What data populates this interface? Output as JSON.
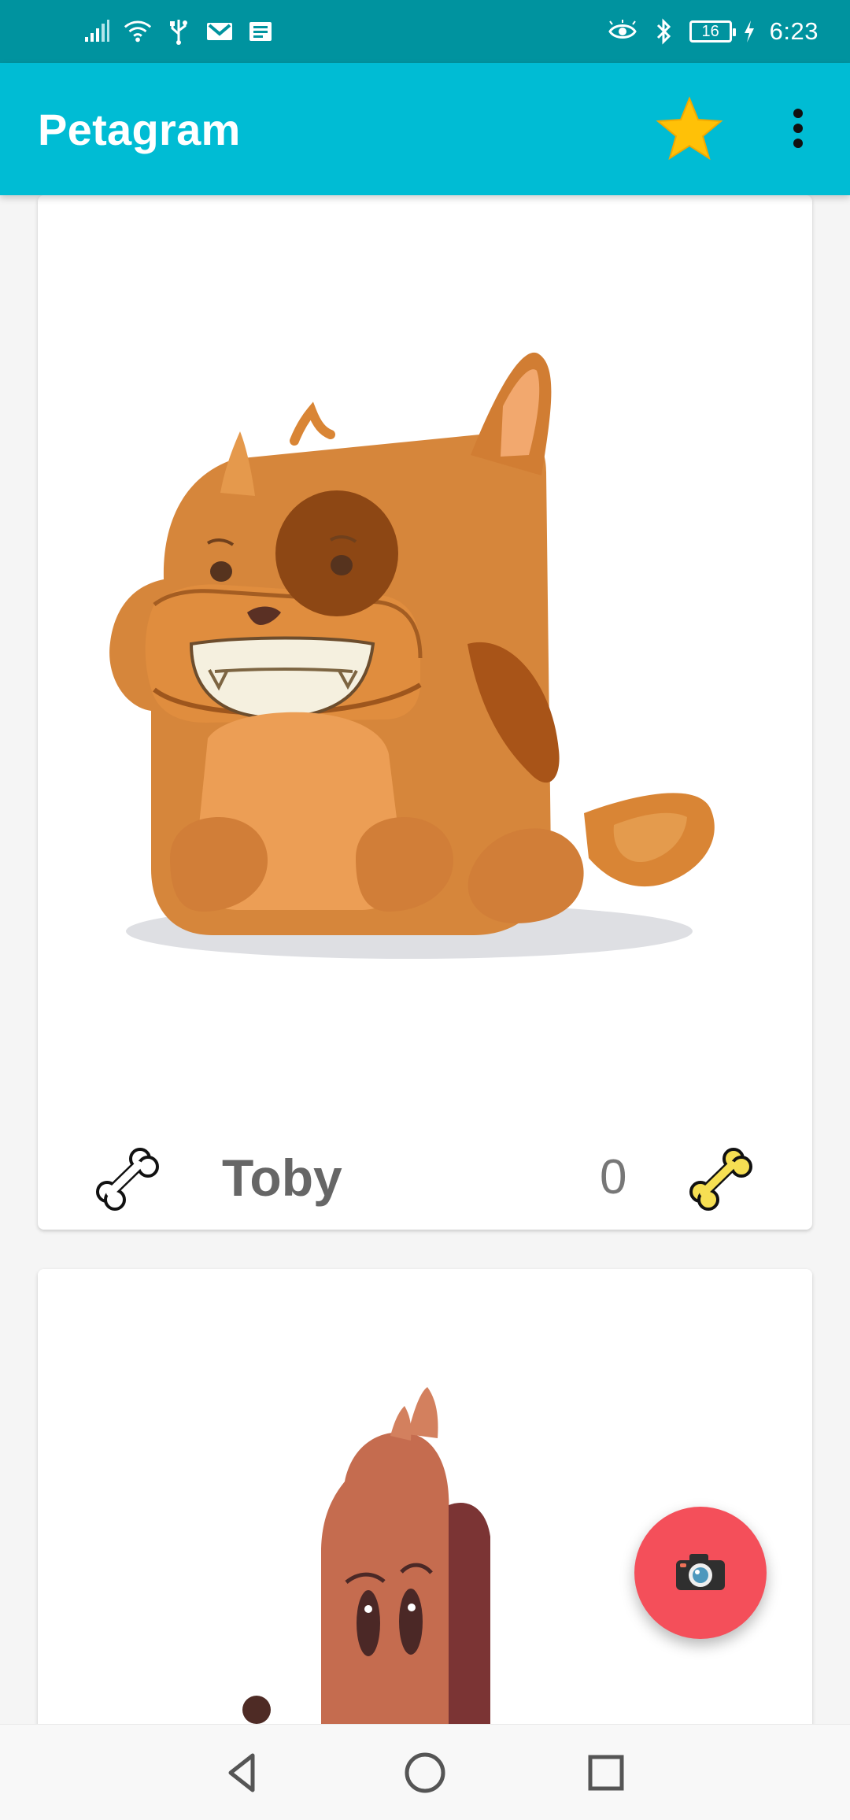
{
  "status_bar": {
    "time": "6:23",
    "battery_level": "16",
    "icons": [
      "signal-icon",
      "wifi-icon",
      "usb-icon",
      "gmail-icon",
      "news-icon",
      "eye-comfort-icon",
      "bluetooth-icon",
      "battery-icon",
      "charging-icon"
    ]
  },
  "app_bar": {
    "title": "Petagram",
    "icons": [
      "star-icon",
      "more-vertical-icon"
    ],
    "accent_color": "#00bcd4"
  },
  "pets": [
    {
      "name": "Toby",
      "rating": "0",
      "image_icon": "orange-dog-illustration"
    },
    {
      "name": "",
      "rating": "",
      "image_icon": "brown-dog-illustration"
    }
  ],
  "fab": {
    "icon": "camera-icon",
    "color": "#f44f5a"
  },
  "navigation": {
    "icons": [
      "back-icon",
      "home-icon",
      "recent-apps-icon"
    ]
  }
}
